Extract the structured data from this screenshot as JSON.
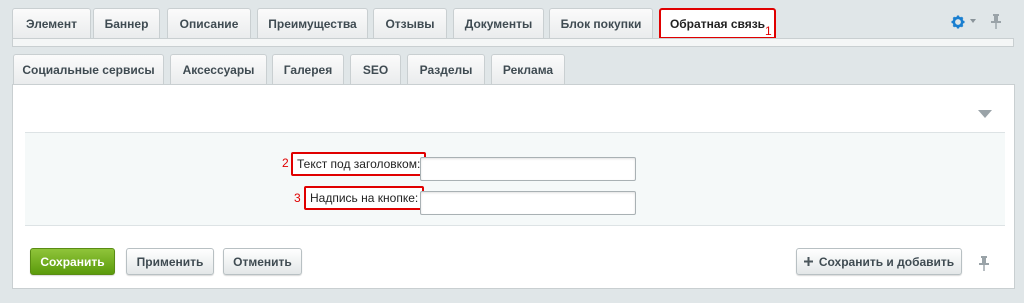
{
  "tabs_row1": [
    {
      "label": "Элемент"
    },
    {
      "label": "Баннер"
    },
    {
      "label": "Описание"
    },
    {
      "label": "Преимущества"
    },
    {
      "label": "Отзывы"
    },
    {
      "label": "Документы"
    },
    {
      "label": "Блок покупки"
    },
    {
      "label": "Обратная связь",
      "active": true
    }
  ],
  "tabs_row2": [
    {
      "label": "Социальные сервисы"
    },
    {
      "label": "Аксессуары"
    },
    {
      "label": "Галерея"
    },
    {
      "label": "SEO"
    },
    {
      "label": "Разделы"
    },
    {
      "label": "Реклама"
    }
  ],
  "annotations": {
    "n1": "1",
    "n2": "2",
    "n3": "3"
  },
  "form": {
    "subtitle_text": {
      "label": "Текст под заголовком:",
      "value": ""
    },
    "button_caption": {
      "label": "Надпись на кнопке:",
      "value": ""
    }
  },
  "buttons": {
    "save": "Сохранить",
    "apply": "Применить",
    "cancel": "Отменить",
    "save_and_add": "Сохранить и добавить"
  },
  "icons": {
    "settings": "gear-icon",
    "settings_dropdown": "chevron-down-icon",
    "pin": "pin-icon",
    "plus": "plus-icon",
    "collapse": "triangle-down-icon"
  },
  "colors": {
    "accent_blue": "#1a7fd0",
    "highlight_red": "#e00000",
    "primary_green": "#6aa91c"
  }
}
